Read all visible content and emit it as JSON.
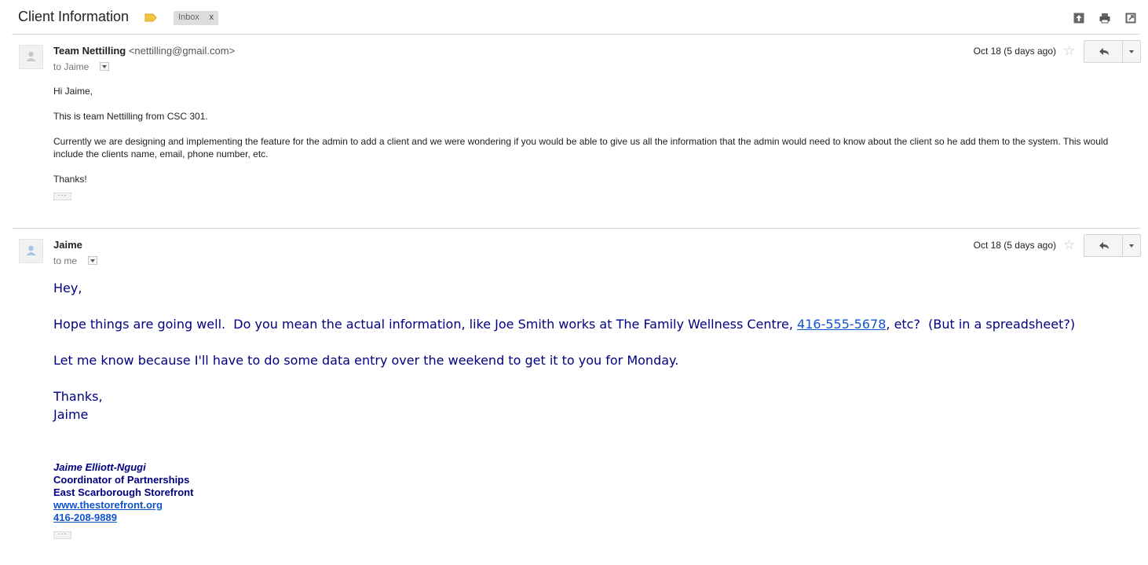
{
  "thread": {
    "subject": "Client Information",
    "label": "Inbox",
    "label_remove": "x"
  },
  "toolbar_icons": [
    "expand-all-icon",
    "print-icon",
    "new-window-icon"
  ],
  "messages": [
    {
      "sender_name": "Team Nettilling",
      "sender_email": "<nettilling@gmail.com>",
      "recipient": "to Jaime",
      "date": "Oct 18 (5 days ago)",
      "body": [
        "Hi Jaime,",
        "This is team Nettilling from CSC 301.",
        "Currently we are designing and implementing the feature for the admin to add a client and we were wondering if you would be able to give us all the information that the admin would need to know about the client so he add them to the system. This would include the clients name, email, phone number, etc.",
        "Thanks!"
      ],
      "trimmed": "···"
    },
    {
      "sender_name": "Jaime",
      "recipient": "to me",
      "date": "Oct 18 (5 days ago)",
      "body": {
        "greeting": "Hey,",
        "line1_before": "Hope things are going well.  Do you mean the actual information, like Joe Smith works at The Family Wellness Centre, ",
        "line1_phone": "416-555-5678",
        "line1_after": ", etc?  (But in a spreadsheet?)",
        "line2": "Let me know because I'll have to do some data entry over the weekend to get it to you for Monday.",
        "closing": "Thanks,",
        "name": "Jaime"
      },
      "signature": {
        "name": "Jaime Elliott-Ngugi",
        "title": "Coordinator of Partnerships",
        "org": "East Scarborough Storefront",
        "website": "www.thestorefront.org",
        "phone": "416-208-9889"
      },
      "trimmed": "···"
    }
  ],
  "colors": {
    "label_yellow": "#f4c542",
    "body_text_navy": "#000080",
    "link_blue": "#1155cc"
  }
}
